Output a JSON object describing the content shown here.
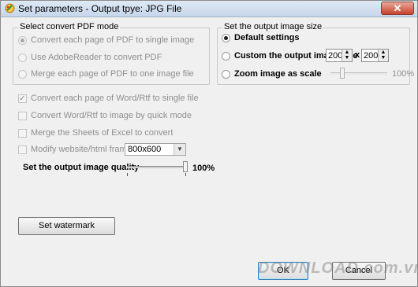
{
  "window": {
    "title": "Set parameters - Output tpye: JPG File",
    "close_glyph": "✕"
  },
  "pdf_group": {
    "title": "Select convert PDF mode",
    "options": [
      {
        "label": "Convert each page of PDF to single image",
        "selected": true
      },
      {
        "label": "Use AdobeReader to convert PDF",
        "selected": false
      },
      {
        "label": "Merge each page of PDF to one image file",
        "selected": false
      }
    ]
  },
  "size_group": {
    "title": "Set the output image size",
    "default_label": "Default settings",
    "custom_label": "Custom the output image size",
    "width_value": "200",
    "times_glyph": "x",
    "height_value": "200",
    "zoom_label": "Zoom image as scale",
    "zoom_percent": "100%",
    "selected": "default"
  },
  "word_options": [
    {
      "label": "Convert each page of Word/Rtf to single file",
      "checked": true
    },
    {
      "label": "Convert Word/Rtf to image by quick mode",
      "checked": false
    },
    {
      "label": "Merge the Sheets of Excel to convert",
      "checked": false
    },
    {
      "label": "Modify website/html frame",
      "checked": false
    }
  ],
  "frame_select": {
    "value": "800x600"
  },
  "quality": {
    "label": "Set the output image quality",
    "percent": "100%",
    "level": 1.0
  },
  "buttons": {
    "watermark": "Set watermark",
    "ok": "OK",
    "cancel": "Cancel"
  },
  "watermark_text": "DOWNLOAD.com.vn",
  "icons": {
    "app": "paint-brush-icon",
    "close": "close-icon",
    "dropdown": "chevron-down-icon",
    "spin": "spin-arrows-icon"
  }
}
